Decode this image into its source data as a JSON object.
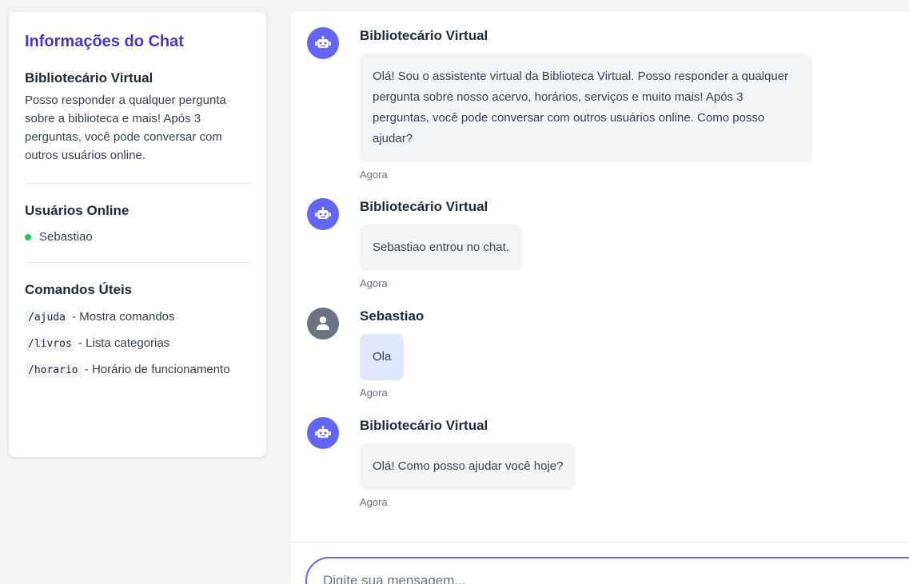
{
  "sidebar": {
    "title": "Informações do Chat",
    "bot_name": "Bibliotecário Virtual",
    "bot_description": "Posso responder a qualquer pergunta sobre a biblioteca e mais! Após 3 perguntas, você pode conversar com outros usuários online.",
    "online_title": "Usuários Online",
    "online_users": [
      "Sebastiao"
    ],
    "commands_title": "Comandos Úteis",
    "commands": [
      {
        "cmd": "/ajuda",
        "desc": " - Mostra comandos"
      },
      {
        "cmd": "/livros",
        "desc": " - Lista categorias"
      },
      {
        "cmd": "/horario",
        "desc": " - Horário de funcionamento"
      }
    ]
  },
  "messages": [
    {
      "sender": "Bibliotecário Virtual",
      "type": "bot",
      "text": "Olá! Sou o assistente virtual da Biblioteca Virtual. Posso responder a qualquer pergunta sobre nosso acervo, horários, serviços e muito mais! Após 3 perguntas, você pode conversar com outros usuários online. Como posso ajudar?",
      "time": "Agora"
    },
    {
      "sender": "Bibliotecário Virtual",
      "type": "bot",
      "text": "Sebastiao entrou no chat.",
      "time": "Agora"
    },
    {
      "sender": "Sebastiao",
      "type": "user",
      "text": "Ola",
      "time": "Agora"
    },
    {
      "sender": "Bibliotecário Virtual",
      "type": "bot",
      "text": "Olá! Como posso ajudar você hoje?",
      "time": "Agora"
    }
  ],
  "input": {
    "placeholder": "Digite sua mensagem..."
  },
  "colors": {
    "accent": "#6366f1",
    "title": "#4338ca",
    "online": "#22c55e",
    "user_bubble": "#e0e7ff",
    "bot_bubble": "#f3f4f6"
  }
}
